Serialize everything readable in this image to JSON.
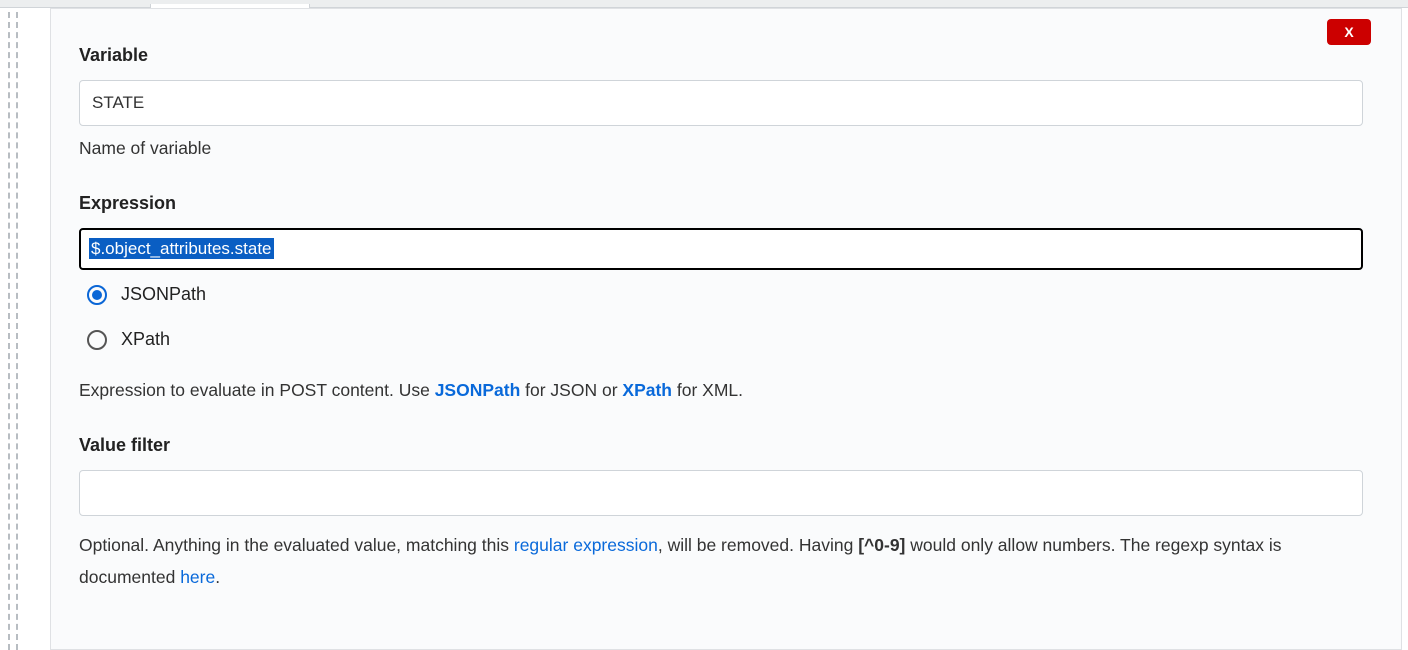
{
  "close_label": "X",
  "variable": {
    "label": "Variable",
    "value": "STATE",
    "help": "Name of variable"
  },
  "expression": {
    "label": "Expression",
    "value": "$.object_attributes.state",
    "options": {
      "jsonpath": "JSONPath",
      "xpath": "XPath"
    },
    "selected": "jsonpath",
    "help_pre": "Expression to evaluate in POST content. Use ",
    "link_jsonpath": "JSONPath",
    "help_mid": " for JSON or ",
    "link_xpath": "XPath",
    "help_post": " for XML."
  },
  "value_filter": {
    "label": "Value filter",
    "value": "",
    "help_pre": "Optional. Anything in the evaluated value, matching this ",
    "link_regex": "regular expression",
    "help_mid1": ", will be removed. Having ",
    "code": "[^0-9]",
    "help_mid2": " would only allow numbers. The regexp syntax is documented ",
    "link_here": "here",
    "help_post": "."
  }
}
